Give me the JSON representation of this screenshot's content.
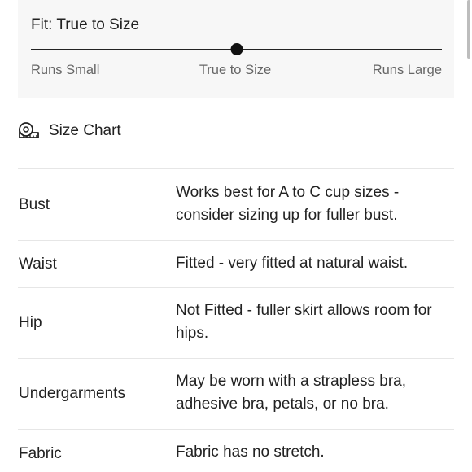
{
  "fit": {
    "title": "Fit: True to Size",
    "slider_position": 0.5,
    "labels": {
      "left": "Runs Small",
      "center": "True to Size",
      "right": "Runs Large"
    }
  },
  "size_chart": {
    "icon": "measuring-tape-icon",
    "label": "Size Chart"
  },
  "details": [
    {
      "name": "Bust",
      "value": "Works best for A to C cup sizes - consider sizing up for fuller bust."
    },
    {
      "name": "Waist",
      "value": "Fitted - very fitted at natural waist."
    },
    {
      "name": "Hip",
      "value": "Not Fitted - fuller skirt allows room for hips."
    },
    {
      "name": "Undergarments",
      "value": "May be worn with a strapless bra, adhesive bra, petals, or no bra."
    },
    {
      "name": "Fabric",
      "value": "Fabric has no stretch."
    }
  ]
}
